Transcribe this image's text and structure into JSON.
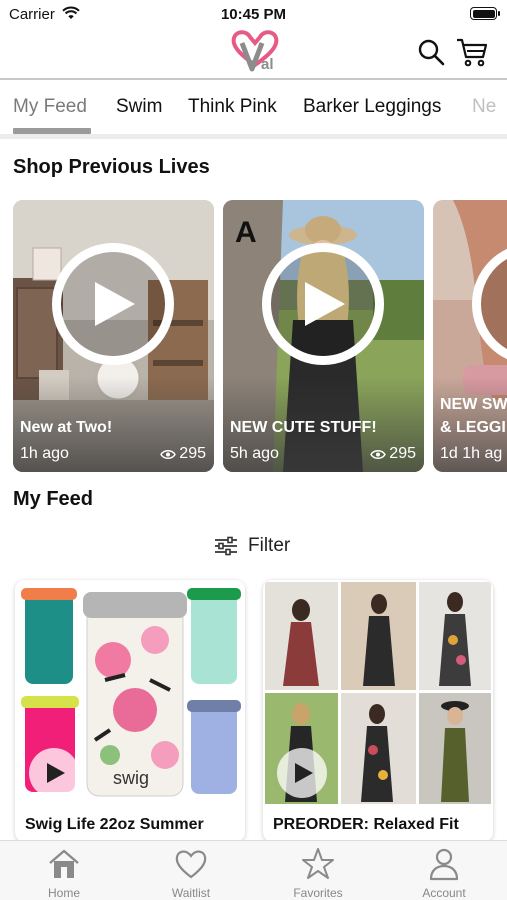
{
  "status_bar": {
    "carrier": "Carrier",
    "time": "10:45 PM"
  },
  "header": {
    "logo_text": "al",
    "logo_subtext": "Val"
  },
  "tabs": [
    {
      "label": "My Feed",
      "active": true
    },
    {
      "label": "Swim"
    },
    {
      "label": "Think Pink"
    },
    {
      "label": "Barker Leggings"
    },
    {
      "label": "Ne"
    }
  ],
  "sections": {
    "previous_lives": "Shop Previous Lives",
    "feed": "My Feed"
  },
  "lives": [
    {
      "title": "New at Two!",
      "time": "1h ago",
      "views": "295"
    },
    {
      "title": "NEW CUTE STUFF!",
      "time": "5h ago",
      "views": "295"
    },
    {
      "title": "NEW SW",
      "title2": "& LEGGI",
      "time": "1d 1h ag"
    }
  ],
  "filter": {
    "label": "Filter"
  },
  "products": [
    {
      "name": "Swig Life 22oz Summer"
    },
    {
      "name": "PREORDER: Relaxed Fit"
    }
  ],
  "bottom_nav": [
    {
      "label": "Home",
      "icon": "home-icon"
    },
    {
      "label": "Waitlist",
      "icon": "heart-icon"
    },
    {
      "label": "Favorites",
      "icon": "star-icon"
    },
    {
      "label": "Account",
      "icon": "user-icon"
    }
  ],
  "colors": {
    "brand_pink": "#e85a86",
    "brand_gray": "#8c8c8c",
    "tab_active": "#7a7a7a"
  }
}
